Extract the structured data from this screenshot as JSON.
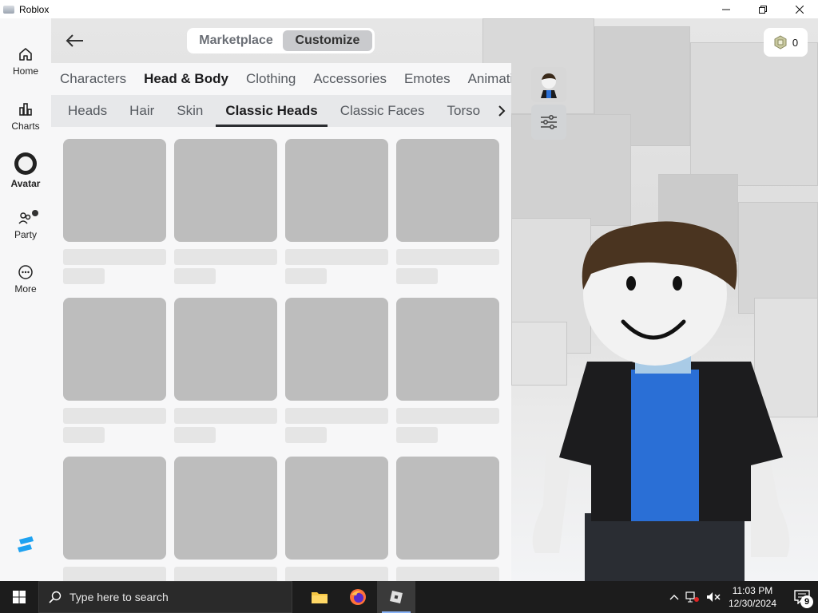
{
  "window": {
    "title": "Roblox",
    "controls": {
      "minimize": "—",
      "maximize": "❐",
      "close": "✕"
    }
  },
  "nav": {
    "items": [
      {
        "label": "Home",
        "icon": "home-icon"
      },
      {
        "label": "Charts",
        "icon": "charts-icon"
      },
      {
        "label": "Avatar",
        "icon": "avatar-icon",
        "active": true
      },
      {
        "label": "Party",
        "icon": "party-icon"
      },
      {
        "label": "More",
        "icon": "more-icon"
      }
    ]
  },
  "header": {
    "segments": {
      "marketplace": "Marketplace",
      "customize": "Customize"
    },
    "robux": {
      "amount": "0"
    }
  },
  "categories": [
    "Characters",
    "Head & Body",
    "Clothing",
    "Accessories",
    "Emotes",
    "Animations"
  ],
  "active_category": "Head & Body",
  "subcategories": [
    "Heads",
    "Hair",
    "Skin",
    "Classic Heads",
    "Classic Faces",
    "Torso"
  ],
  "active_subcategory": "Classic Heads",
  "taskbar": {
    "search_placeholder": "Type here to search",
    "time": "11:03 PM",
    "date": "12/30/2024",
    "notifications": "9"
  },
  "colors": {
    "accent": "#2b2d31",
    "placeholder": "#bdbdbd",
    "panel": "#f7f7f8"
  }
}
